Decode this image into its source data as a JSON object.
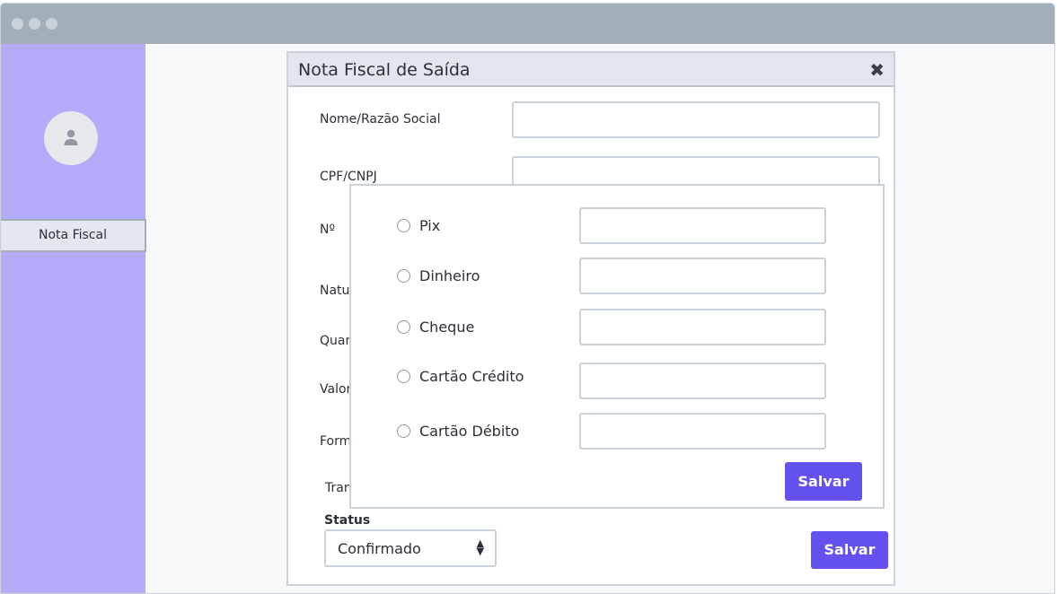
{
  "sidebar": {
    "avatar_icon": "user-icon",
    "nav_item": "Nota Fiscal"
  },
  "dialog": {
    "title": "Nota Fiscal de Saída",
    "close_icon": "close-icon",
    "fields": {
      "nome": "Nome/Razão Social",
      "cpf": "CPF/CNPJ",
      "numero": "Nº",
      "natureza": "Natu",
      "quantidade": "Quan",
      "valor": "Valor",
      "forma": "Form",
      "transporte": "Tran"
    },
    "status": {
      "label": "Status",
      "selected": "Confirmado"
    },
    "save_label": "Salvar"
  },
  "payment_popup": {
    "options": [
      {
        "label": "Pix",
        "value": ""
      },
      {
        "label": "Dinheiro",
        "value": ""
      },
      {
        "label": "Cheque",
        "value": ""
      },
      {
        "label": "Cartão Crédito",
        "value": ""
      },
      {
        "label": "Cartão Débito",
        "value": ""
      }
    ],
    "save_label": "Salvar"
  },
  "colors": {
    "titlebar": "#a1afbb",
    "sidebar": "#b1abf8",
    "accent": "#6452f0"
  }
}
